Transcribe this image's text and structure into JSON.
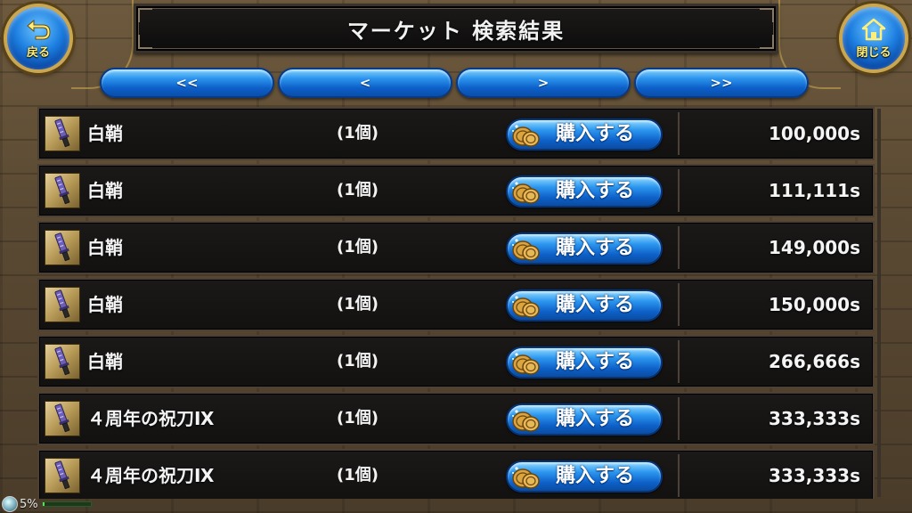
{
  "header": {
    "title": "マーケット 検索結果",
    "back_label": "戻る",
    "close_label": "閉じる"
  },
  "pager": {
    "first": "<<",
    "prev": "<",
    "next": ">",
    "last": ">>"
  },
  "listings": [
    {
      "name": "白鞘",
      "quantity": "(1個)",
      "buy_label": "購入する",
      "price": "100,000s"
    },
    {
      "name": "白鞘",
      "quantity": "(1個)",
      "buy_label": "購入する",
      "price": "111,111s"
    },
    {
      "name": "白鞘",
      "quantity": "(1個)",
      "buy_label": "購入する",
      "price": "149,000s"
    },
    {
      "name": "白鞘",
      "quantity": "(1個)",
      "buy_label": "購入する",
      "price": "150,000s"
    },
    {
      "name": "白鞘",
      "quantity": "(1個)",
      "buy_label": "購入する",
      "price": "266,666s"
    },
    {
      "name": "４周年の祝刀Ⅸ",
      "quantity": "(1個)",
      "buy_label": "購入する",
      "price": "333,333s"
    },
    {
      "name": "４周年の祝刀Ⅸ",
      "quantity": "(1個)",
      "buy_label": "購入する",
      "price": "333,333s"
    }
  ],
  "status": {
    "percent": "5%",
    "gauge_fraction": 0.05
  },
  "icons": {
    "back": "back-arrow-icon",
    "close": "home-icon",
    "item": "sword-icon",
    "buy": "coin-icon"
  },
  "colors": {
    "button_blue": "#1d7fe0",
    "gold_trim": "#c9a752",
    "row_bg": "#151413",
    "text": "#f4f4f4",
    "label_yellow": "#ffef7a"
  }
}
